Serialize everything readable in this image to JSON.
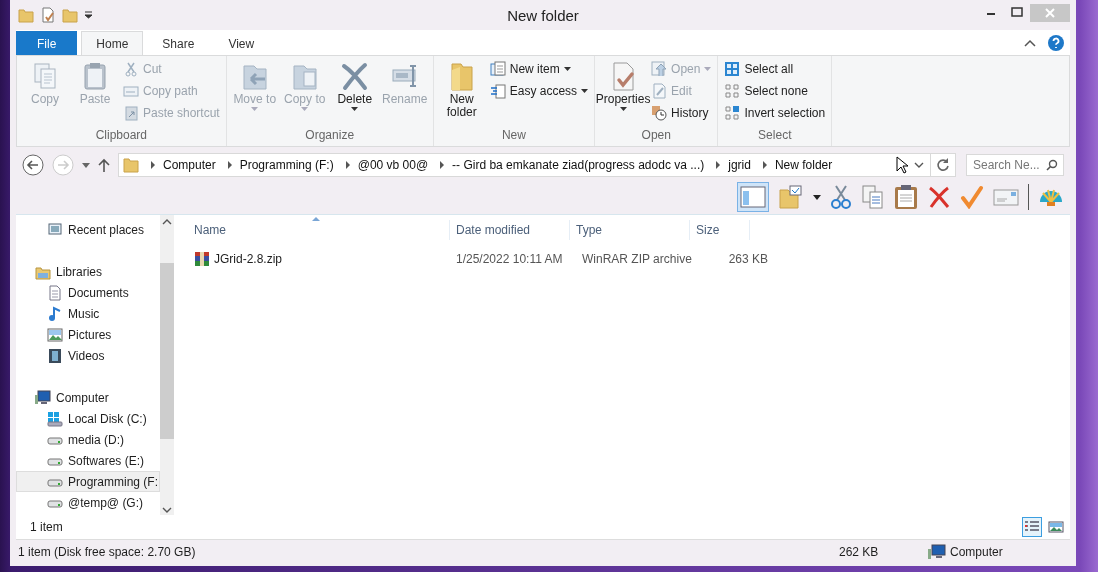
{
  "window": {
    "title": "New folder"
  },
  "tabs": [
    {
      "label": "File",
      "kind": "file",
      "selected": false
    },
    {
      "label": "Home",
      "kind": "tab",
      "selected": true
    },
    {
      "label": "Share",
      "kind": "tab",
      "selected": false
    },
    {
      "label": "View",
      "kind": "tab",
      "selected": false
    }
  ],
  "ribbon": [
    {
      "label": "Clipboard",
      "items": [
        {
          "label": "Copy",
          "kind": "large",
          "disabled": true,
          "dropdown": false
        },
        {
          "label": "Paste",
          "kind": "large",
          "disabled": true,
          "dropdown": false
        },
        {
          "label": "Cut",
          "kind": "small",
          "disabled": true,
          "dropdown": false
        },
        {
          "label": "Copy path",
          "kind": "small",
          "disabled": true,
          "dropdown": false
        },
        {
          "label": "Paste shortcut",
          "kind": "small",
          "disabled": true,
          "dropdown": false
        }
      ]
    },
    {
      "label": "Organize",
      "items": [
        {
          "label": "Move to",
          "kind": "large",
          "disabled": true,
          "dropdown": true
        },
        {
          "label": "Copy to",
          "kind": "large",
          "disabled": true,
          "dropdown": true
        },
        {
          "label": "Delete",
          "kind": "large",
          "disabled": false,
          "dropdown": true
        },
        {
          "label": "Rename",
          "kind": "large",
          "disabled": true,
          "dropdown": false
        }
      ]
    },
    {
      "label": "New",
      "items": [
        {
          "label": "New folder",
          "kind": "large",
          "disabled": false,
          "dropdown": false
        },
        {
          "label": "New item",
          "kind": "small",
          "disabled": false,
          "dropdown": true
        },
        {
          "label": "Easy access",
          "kind": "small",
          "disabled": false,
          "dropdown": true
        }
      ]
    },
    {
      "label": "Open",
      "items": [
        {
          "label": "Properties",
          "kind": "large",
          "disabled": false,
          "dropdown": true
        },
        {
          "label": "Open",
          "kind": "small",
          "disabled": true,
          "dropdown": true
        },
        {
          "label": "Edit",
          "kind": "small",
          "disabled": true,
          "dropdown": false
        },
        {
          "label": "History",
          "kind": "small",
          "disabled": false,
          "dropdown": false
        }
      ]
    },
    {
      "label": "Select",
      "items": [
        {
          "label": "Select all",
          "kind": "small",
          "disabled": false,
          "dropdown": false
        },
        {
          "label": "Select none",
          "kind": "small",
          "disabled": false,
          "dropdown": false
        },
        {
          "label": "Invert selection",
          "kind": "small",
          "disabled": false,
          "dropdown": false
        }
      ]
    }
  ],
  "address": {
    "crumbs": [
      "Computer",
      "Programming (F:)",
      "@00 vb 00@",
      "-- Gird ba emkanate ziad(progress adodc va ...)",
      "jgrid",
      "New folder"
    ]
  },
  "search": {
    "placeholder": "Search Ne..."
  },
  "nav": [
    {
      "children": [
        {
          "label": "Recent places",
          "selected": false
        }
      ]
    },
    {
      "label": "Libraries",
      "selected": false,
      "children": [
        {
          "label": "Documents",
          "selected": false
        },
        {
          "label": "Music",
          "selected": false
        },
        {
          "label": "Pictures",
          "selected": false
        },
        {
          "label": "Videos",
          "selected": false
        }
      ]
    },
    {
      "label": "Computer",
      "selected": false,
      "children": [
        {
          "label": "Local Disk (C:)",
          "selected": false
        },
        {
          "label": "media (D:)",
          "selected": false
        },
        {
          "label": "Softwares (E:)",
          "selected": false
        },
        {
          "label": "Programming (F:",
          "selected": true
        },
        {
          "label": "@temp@ (G:)",
          "selected": false
        }
      ]
    }
  ],
  "columns": [
    {
      "label": "Name",
      "sorted": true
    },
    {
      "label": "Date modified",
      "sorted": false
    },
    {
      "label": "Type",
      "sorted": false
    },
    {
      "label": "Size",
      "sorted": false
    }
  ],
  "rows": [
    {
      "name": "JGrid-2.8.zip",
      "date": "1/25/2022 10:11 AM",
      "type": "WinRAR ZIP archive",
      "size": "263 KB"
    }
  ],
  "item_count": "1 item",
  "view_modes": [
    {
      "kind": "details",
      "selected": true
    },
    {
      "kind": "preview",
      "selected": false
    }
  ],
  "status_bar": {
    "summary": "1 item (Disk free space: 2.70 GB)",
    "size": "262 KB",
    "location": "Computer"
  }
}
